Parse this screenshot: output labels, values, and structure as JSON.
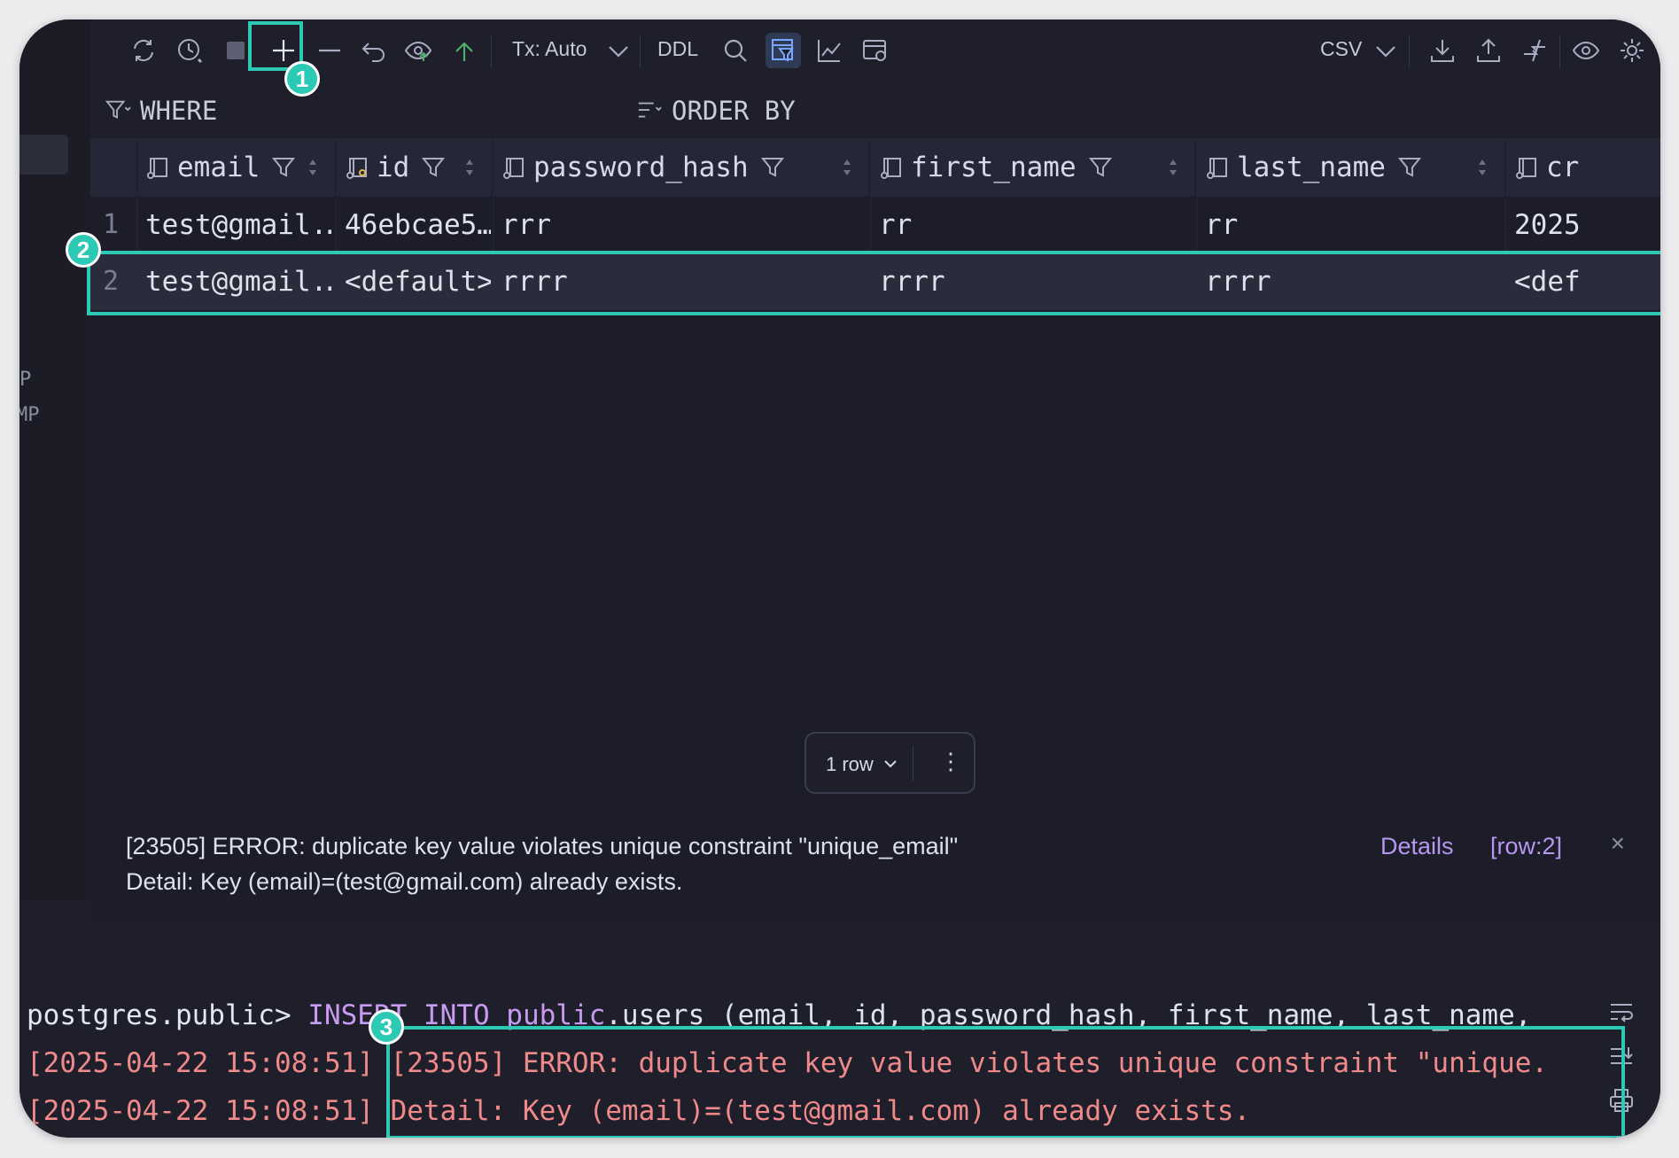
{
  "toolbar": {
    "tx_mode": "Tx: Auto",
    "ddl": "DDL",
    "export_format": "CSV",
    "icons": [
      "refresh-icon",
      "history-icon",
      "stop-icon",
      "add-row-icon",
      "remove-row-icon",
      "undo-icon",
      "preview-submit-icon",
      "submit-icon",
      "search-icon",
      "filter-view-icon",
      "chart-icon",
      "view-settings-icon",
      "download-icon",
      "upload-icon",
      "compare-icon",
      "eye-icon",
      "gear-icon"
    ]
  },
  "filters": {
    "where": "WHERE",
    "order_by": "ORDER BY"
  },
  "left_panel": {
    "label1": "P",
    "label2": "MP"
  },
  "table": {
    "columns": [
      "email",
      "id",
      "password_hash",
      "first_name",
      "last_name",
      "cr"
    ],
    "rows": [
      {
        "num": "1",
        "email": "test@gmail.…",
        "id": "46ebcae5…",
        "password_hash": "rrr",
        "first_name": "rr",
        "last_name": "rr",
        "created": "2025"
      },
      {
        "num": "2",
        "email": "test@gmail.…",
        "id": "<default>",
        "password_hash": "rrrr",
        "first_name": "rrrr",
        "last_name": "rrrr",
        "created": "<def"
      }
    ]
  },
  "pager": {
    "rows_label": "1 row",
    "more": "⋮"
  },
  "error": {
    "line1": "[23505] ERROR: duplicate key value violates unique constraint \"unique_email\"",
    "line2": "Detail: Key (email)=(test@gmail.com) already exists.",
    "details_link": "Details",
    "row_link": "[row:2]",
    "close": "×"
  },
  "console": {
    "prompt": "postgres.public>",
    "sql_kw1": "INSERT",
    "sql_kw2": "INTO",
    "sql_schema": "public",
    "sql_rest": ".users (email, id, password_hash, first_name, last_name,",
    "ts1": "[2025-04-22 15:08:51]",
    "msg1": "[23505] ERROR: duplicate key value violates unique constraint \"unique.",
    "ts2": "[2025-04-22 15:08:51]",
    "msg2": "Detail: Key (email)=(test@gmail.com) already exists."
  },
  "annotations": {
    "b1": "1",
    "b2": "2",
    "b3": "3"
  },
  "colors": {
    "accent": "#2cc9b4",
    "error_text": "#f08a8a",
    "link": "#b596f0",
    "keyword": "#c79bf2"
  }
}
